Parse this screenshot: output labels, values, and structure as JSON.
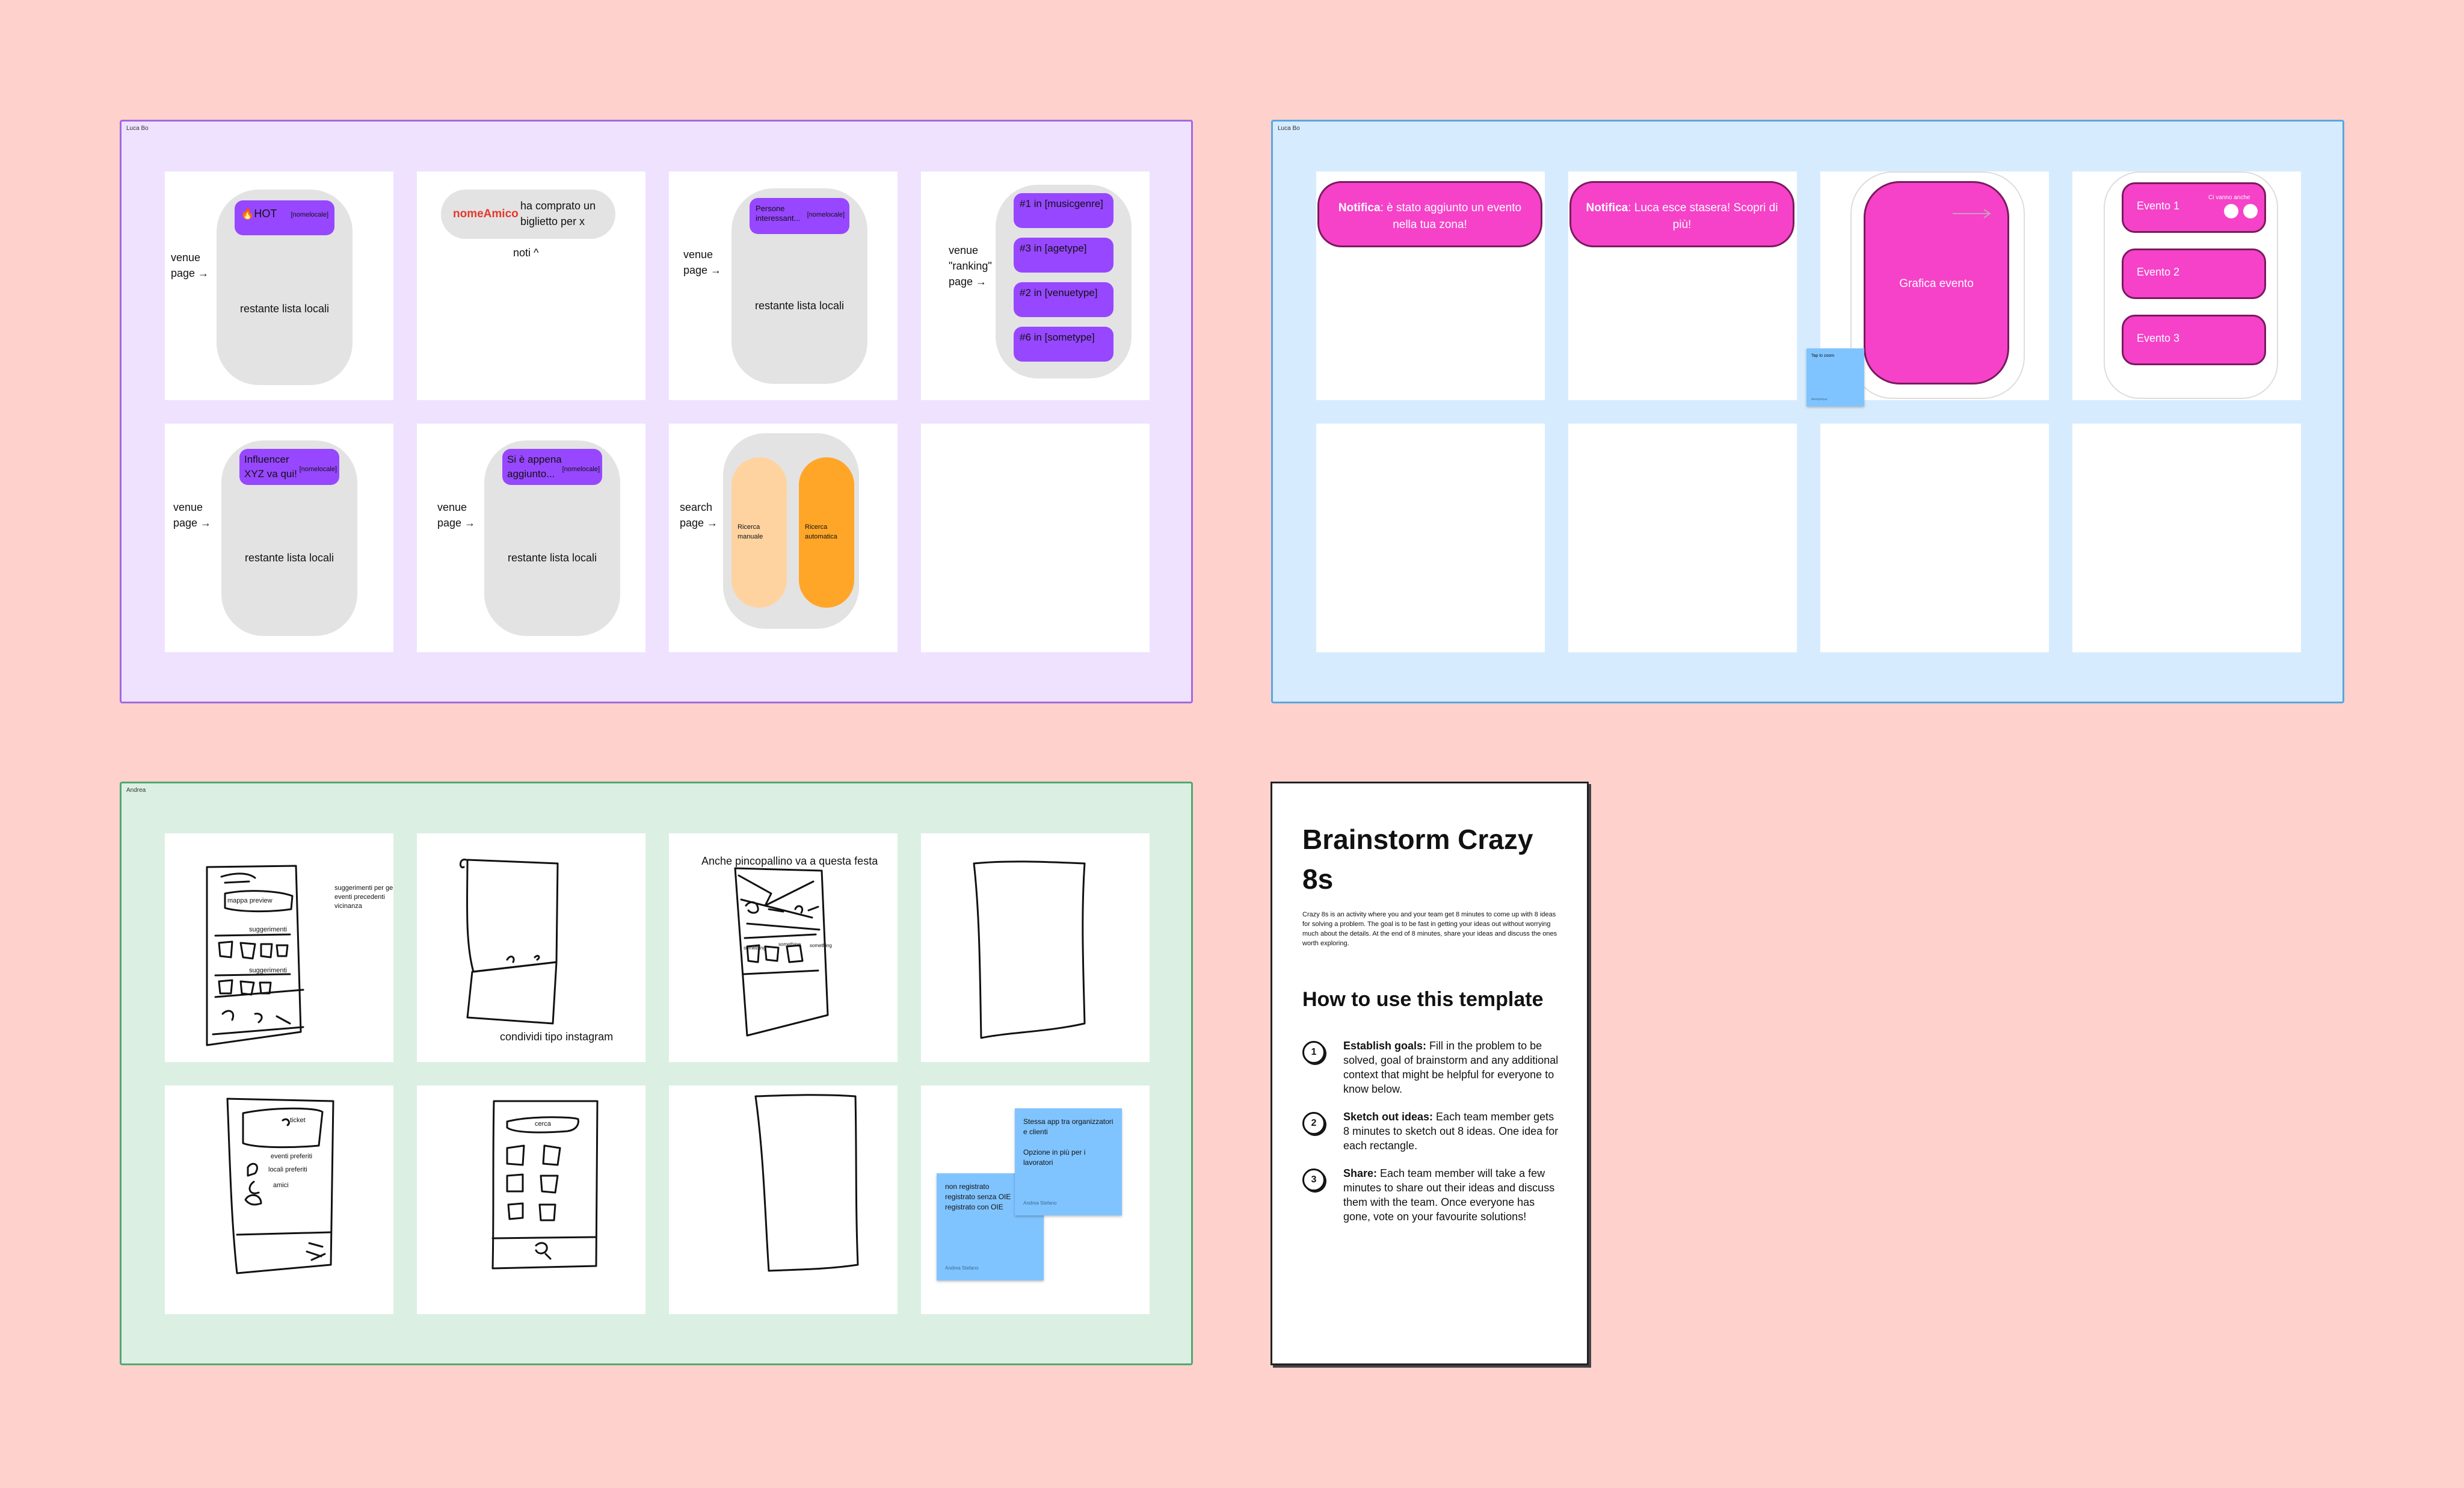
{
  "sections": {
    "purple": {
      "label": "Luca Bo",
      "bg": "#efe2ff",
      "border": "#a06ae0"
    },
    "blue": {
      "label": "Luca Bo",
      "bg": "#d6ecfe",
      "border": "#5aa6e0"
    },
    "green": {
      "label": "Andrea",
      "bg": "#dbf0e3",
      "border": "#52a870"
    }
  },
  "purple_cards": {
    "c1": {
      "chip_title": "🔥HOT",
      "chip_tag": "[nomelocale]",
      "side": "venue\npage →",
      "list": "restante lista locali"
    },
    "c2": {
      "friend": "nomeAmico",
      "message": "ha comprato un biglietto per x",
      "caption": "noti ^"
    },
    "c3": {
      "chip_title": "Persone interessant...",
      "chip_tag": "[nomelocale]",
      "side": "venue\npage →",
      "list": "restante lista locali"
    },
    "c4": {
      "side": "venue\n\"ranking\"\npage →",
      "ranks": [
        "#1 in [musicgenre]",
        "#3 in [agetype]",
        "#2 in [venuetype]",
        "#6 in [sometype]"
      ]
    },
    "c5": {
      "chip_title": "Influencer XYZ va qui!",
      "chip_tag": "[nomelocale]",
      "side": "venue\npage →",
      "list": "restante lista locali"
    },
    "c6": {
      "chip_title": "Si è appena aggiunto...",
      "chip_tag": "[nomelocale]",
      "side": "venue\npage →",
      "list": "restante lista locali"
    },
    "c7": {
      "side": "search\npage →",
      "manual": "Ricerca manuale",
      "auto": "Ricerca automatica"
    }
  },
  "blue_cards": {
    "notif1": {
      "bold": "Notifica",
      "text": ": è stato aggiunto un evento nella tua zona!"
    },
    "notif2": {
      "bold": "Notifica",
      "text": ": Luca esce stasera! Scopri di più!"
    },
    "event_graphic": "Grafica evento",
    "sticky_title": "Tap to zoom",
    "sticky_author": "Anonymous",
    "events": [
      "Evento 1",
      "Evento 2",
      "Evento 3"
    ],
    "friends_going": "Ci vanno anche"
  },
  "green_cards": {
    "g1": {
      "note": "suggerimenti per genere\neventi precedenti\nvicinanza",
      "map": "mappa preview",
      "sugg1": "suggerimenti",
      "sugg2": "suggerimenti"
    },
    "g2": {
      "caption": "condividi tipo instagram"
    },
    "g3": {
      "caption": "Anche pincopallino va a questa festa",
      "a": "something",
      "b": "something",
      "c": "something"
    },
    "g5": {
      "ticket": "ticket",
      "fav_events": "eventi preferiti",
      "fav_venues": "locali preferiti",
      "friends": "amici"
    },
    "g6": {
      "search": "cerca"
    },
    "g8": {
      "sticky_a": {
        "lines": "Stessa app tra organizzatori e clienti\n\nOpzione in più per i lavoratori",
        "author": "Andrea Stefano"
      },
      "sticky_b": {
        "lines": "non registrato\nregistrato senza OIE\nregistrato con OIE",
        "author": "Andrea Stefano"
      }
    }
  },
  "template": {
    "title": "Brainstorm Crazy 8s",
    "intro": "Crazy 8s is an activity where you and your team get 8 minutes to come up with 8 ideas for solving a problem. The goal is to be fast in getting your ideas out without worrying much about the details. At the end of 8 minutes, share your ideas and discuss the ones worth exploring.",
    "how_title": "How to use this template",
    "steps": [
      {
        "num": "1",
        "bold": "Establish goals:",
        "text": " Fill in the problem to be solved, goal of brainstorm and any additional context that might be helpful for everyone to know below."
      },
      {
        "num": "2",
        "bold": "Sketch out ideas:",
        "text": " Each team member gets 8 minutes to sketch out 8 ideas. One idea for each rectangle."
      },
      {
        "num": "3",
        "bold": "Share:",
        "text": " Each team member will take a few minutes to share out their ideas and discuss them with the team. Once everyone has gone, vote on your favourite solutions!"
      }
    ]
  }
}
